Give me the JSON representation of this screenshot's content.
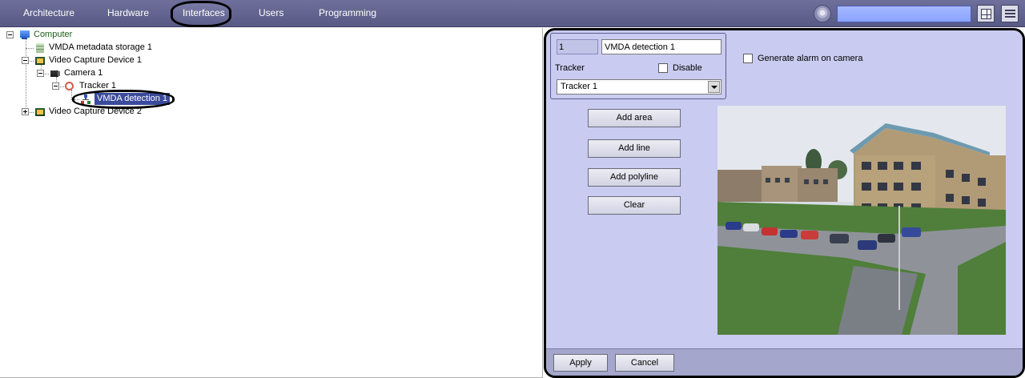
{
  "nav": {
    "items": [
      "Architecture",
      "Hardware",
      "Interfaces",
      "Users",
      "Programming"
    ],
    "active": "Interfaces"
  },
  "toolbar": {
    "search_value": "",
    "icons": [
      "settings-icon",
      "layout-grid-icon",
      "menu-list-icon"
    ]
  },
  "tree": {
    "nodes": [
      {
        "label": "Computer",
        "icon": "computer-icon",
        "expanded": true
      },
      {
        "label": "VMDA metadata storage 1",
        "icon": "storage-icon"
      },
      {
        "label": "Video Capture Device 1",
        "icon": "capture-board-icon",
        "expanded": true
      },
      {
        "label": "Camera 1",
        "icon": "camera-icon",
        "expanded": true
      },
      {
        "label": "Tracker 1",
        "icon": "tracker-icon",
        "expanded": true
      },
      {
        "label": "VMDA detection 1",
        "icon": "vmda-icon",
        "selected": true
      },
      {
        "label": "Video Capture Device 2",
        "icon": "capture-board-icon",
        "expanded": false
      }
    ]
  },
  "panel": {
    "id_value": "1",
    "name_value": "VMDA detection 1",
    "tracker_label": "Tracker",
    "disable_label": "Disable",
    "disable_checked": false,
    "tracker_select": "Tracker 1",
    "alarm_label": "Generate alarm on camera",
    "alarm_checked": false,
    "buttons": {
      "add_area": "Add area",
      "add_line": "Add line",
      "add_polyline": "Add polyline",
      "clear": "Clear"
    },
    "footer": {
      "apply": "Apply",
      "cancel": "Cancel"
    }
  },
  "colors": {
    "topbar": "#5f618d",
    "panel_bg": "#c9cbf0",
    "selection": "#3a4a9b",
    "search_bg": "#97adff"
  }
}
